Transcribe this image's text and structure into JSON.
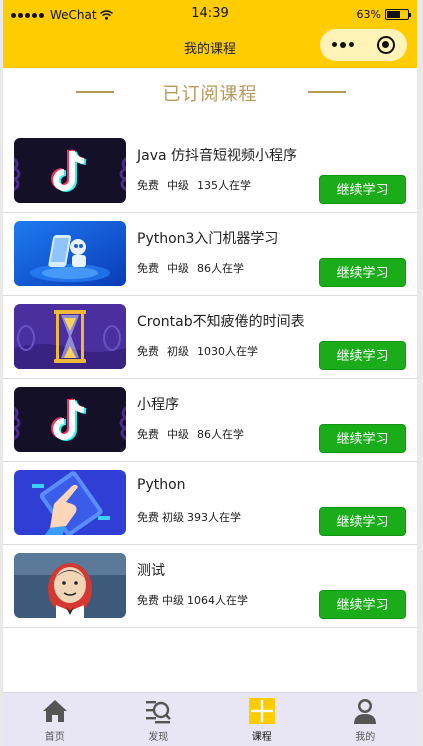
{
  "status_bar": {
    "carrier": "WeChat",
    "time": "14:39",
    "battery": "63%"
  },
  "nav": {
    "title": "我的课程"
  },
  "section": {
    "title": "已订阅课程"
  },
  "courses": [
    {
      "title": "Java 仿抖音短视频小程序",
      "price": "免费",
      "level": "中级",
      "learners": "135人在学",
      "button": "继续学习",
      "thumb": "tiktok"
    },
    {
      "title": "Python3入门机器学习",
      "price": "免费",
      "level": "中级",
      "learners": "86人在学",
      "button": "继续学习",
      "thumb": "robot"
    },
    {
      "title": "Crontab不知疲倦的时间表",
      "price": "免费",
      "level": "初级",
      "learners": "1030人在学",
      "button": "继续学习",
      "thumb": "hourglass"
    },
    {
      "title": "小程序",
      "price": "免费",
      "level": "中级",
      "learners": "86人在学",
      "button": "继续学习",
      "thumb": "tiktok"
    },
    {
      "title": "Python",
      "price": "免费",
      "level": "初级",
      "learners": "393人在学",
      "button": "继续学习",
      "thumb": "tablet-hand"
    },
    {
      "title": "测试",
      "price": "免费",
      "level": "中级",
      "learners": "1064人在学",
      "button": "继续学习",
      "thumb": "jenkins"
    }
  ],
  "tabbar": [
    {
      "label": "首页",
      "icon": "home-icon"
    },
    {
      "label": "发现",
      "icon": "discover-icon"
    },
    {
      "label": "课程",
      "icon": "course-icon",
      "active": true
    },
    {
      "label": "我的",
      "icon": "profile-icon"
    }
  ],
  "colors": {
    "header": "#ffcc00",
    "accent_text": "#b59a5b",
    "button": "#1aad19",
    "tabbar": "#e8e6f4"
  }
}
